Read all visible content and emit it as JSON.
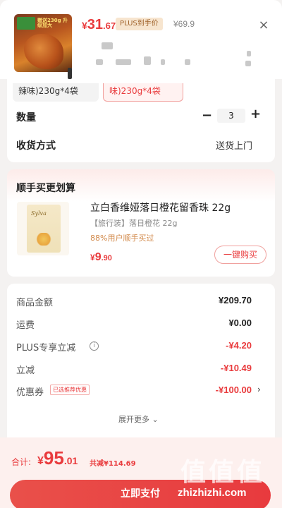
{
  "product": {
    "thumb_text": "赠送230g 升级加大",
    "price_symbol": "¥",
    "price_int": "31",
    "price_dec": ".67",
    "plus_badge": "PLUS到手价",
    "original_price": "¥69.9",
    "close_glyph": "×"
  },
  "spec": {
    "option_a": "辣味)230g*4袋",
    "option_b": "味)230g*4袋",
    "quantity_label": "数量",
    "quantity_minus": "−",
    "quantity_value": "3",
    "quantity_plus": "+",
    "delivery_label": "收货方式",
    "delivery_value": "送货上门"
  },
  "addon": {
    "title": "顺手买更划算",
    "pack_logo": "Sylva",
    "name": "立白香维娅落日橙花留香珠 22g",
    "spec": "【旅行装】落日橙花 22g",
    "bought": "88%用户顺手买过",
    "price_symbol": "¥",
    "price_int": "9",
    "price_dec": ".90",
    "buy_label": "一键购买"
  },
  "summary": {
    "rows": [
      {
        "label": "商品金额",
        "value": "¥209.70"
      },
      {
        "label": "运费",
        "value": "¥0.00"
      },
      {
        "label": "PLUS专享立减",
        "value": "-¥4.20"
      },
      {
        "label": "立减",
        "value": "-¥10.49"
      },
      {
        "label": "优惠券",
        "value": "-¥100.00"
      }
    ],
    "info_glyph": "i",
    "coupon_tag": "已选推荐优惠",
    "coupon_arrow": "›",
    "more_label": "展开更多 ⌄"
  },
  "footer": {
    "total_label": "合计:",
    "total_symbol": "¥",
    "total_int": "95",
    "total_dec": ".01",
    "total_discount": "共减¥114.69",
    "pay_label": "立即支付"
  },
  "watermark": {
    "glyphs": "值值值",
    "url": "zhizhizhi.com"
  },
  "colors": {
    "accent_red": "#e93b3d",
    "plus_gold": "#a0622a",
    "footer_bg": "#fdf0ee"
  }
}
